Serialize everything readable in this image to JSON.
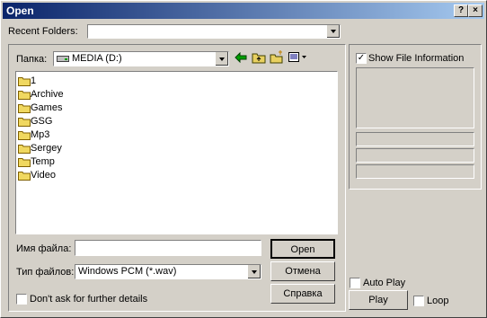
{
  "window": {
    "title": "Open"
  },
  "titlebar_buttons": {
    "help": "?",
    "close": "×"
  },
  "recent": {
    "label": "Recent Folders:",
    "value": ""
  },
  "lookin": {
    "label": "Папка:",
    "value": "MEDIA (D:)"
  },
  "files": [
    {
      "name": "1"
    },
    {
      "name": "Archive"
    },
    {
      "name": "Games"
    },
    {
      "name": "GSG"
    },
    {
      "name": "Mp3"
    },
    {
      "name": "Sergey"
    },
    {
      "name": "Temp"
    },
    {
      "name": "Video"
    }
  ],
  "filename": {
    "label": "Имя файла:",
    "value": ""
  },
  "filetype": {
    "label": "Тип файлов:",
    "value": "Windows PCM (*.wav)"
  },
  "buttons": {
    "open": "Open",
    "cancel": "Отмена",
    "help": "Справка",
    "play": "Play"
  },
  "dont_ask": {
    "label": "Don't ask for further details",
    "checked": false
  },
  "show_info": {
    "label": "Show File Information",
    "checked": true
  },
  "auto_play": {
    "label": "Auto Play",
    "checked": false
  },
  "loop": {
    "label": "Loop",
    "checked": false
  },
  "icons": [
    "back-arrow-icon",
    "up-folder-icon",
    "new-folder-icon",
    "view-menu-icon",
    "drive-icon",
    "folder-icon"
  ]
}
